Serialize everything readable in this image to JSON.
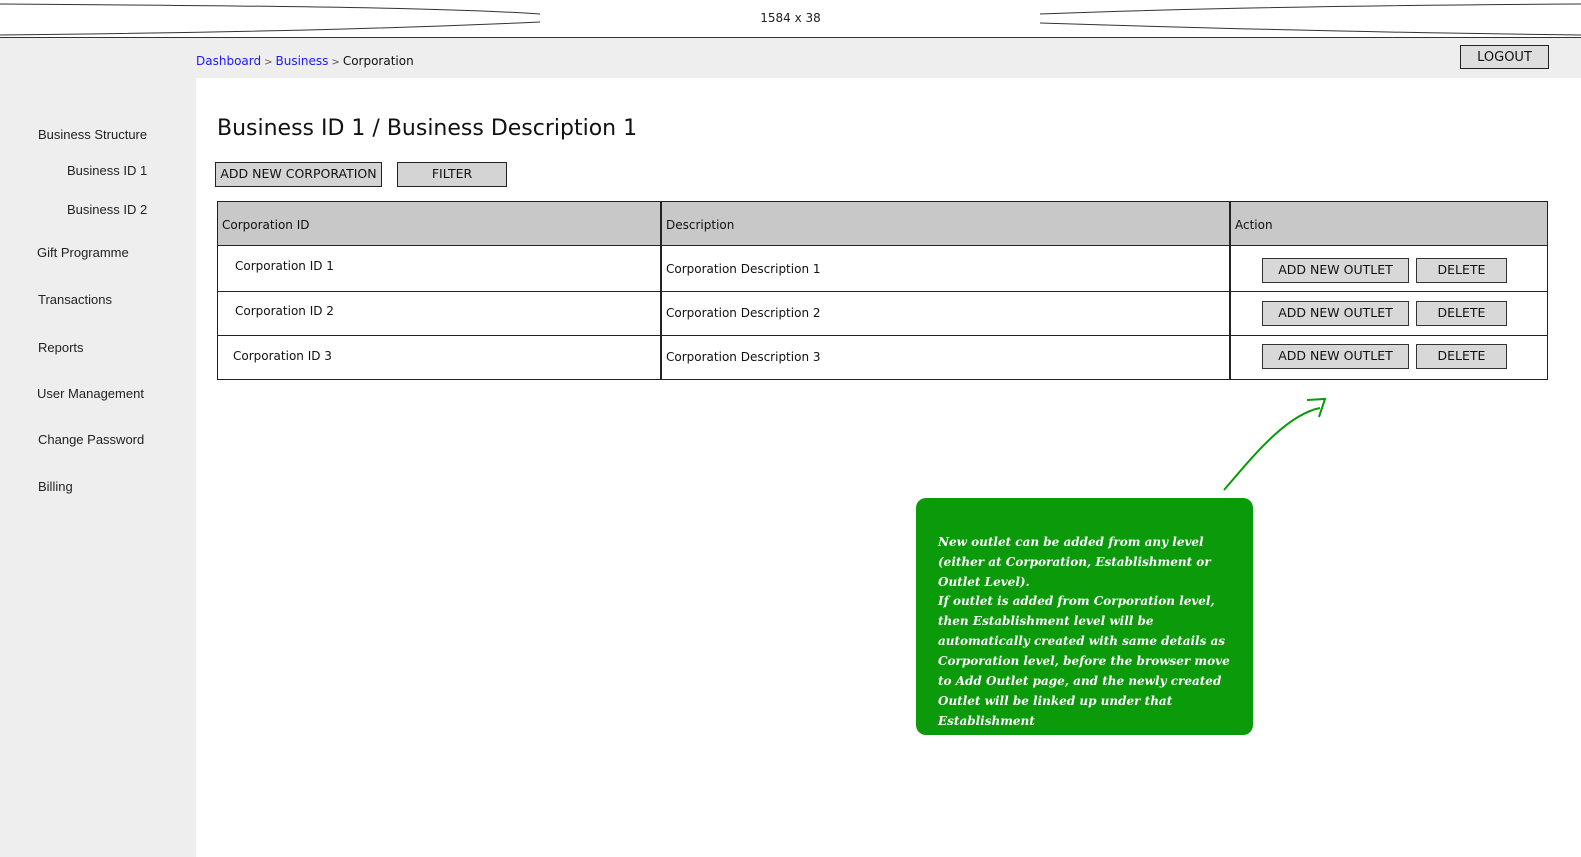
{
  "banner": {
    "dimensions": "1584 x 38"
  },
  "breadcrumb": {
    "items": [
      "Dashboard",
      "Business"
    ],
    "current": "Corporation",
    "separator": ">"
  },
  "header": {
    "logout_label": "LOGOUT"
  },
  "sidebar": {
    "items": [
      {
        "label": "Business Structure"
      },
      {
        "label": "Business ID 1"
      },
      {
        "label": "Business ID 2"
      },
      {
        "label": "Gift Programme"
      },
      {
        "label": "Transactions"
      },
      {
        "label": "Reports"
      },
      {
        "label": "User Management"
      },
      {
        "label": "Change Password"
      },
      {
        "label": "Billing"
      }
    ]
  },
  "main": {
    "title": "Business ID 1 / Business Description 1",
    "toolbar": {
      "add_label": "ADD NEW CORPORATION",
      "filter_label": "FILTER"
    },
    "table": {
      "columns": [
        "Corporation ID",
        "Description",
        "Action"
      ],
      "rows": [
        {
          "id": "Corporation ID 1",
          "description": "Corporation Description 1",
          "add_outlet": "ADD NEW OUTLET",
          "delete": "DELETE"
        },
        {
          "id": "Corporation ID 2",
          "description": "Corporation Description 2",
          "add_outlet": "ADD NEW OUTLET",
          "delete": "DELETE"
        },
        {
          "id": "Corporation ID 3",
          "description": "Corporation Description 3",
          "add_outlet": "ADD NEW OUTLET",
          "delete": "DELETE"
        }
      ]
    }
  },
  "note": {
    "color": "#0a9a0a",
    "paragraph1": "New outlet can be added from any level (either at Corporation, Establishment or Outlet Level).",
    "paragraph2": "If outlet is added from Corporation level, then Establishment level will be automatically created with same details as Corporation level, before the browser move to Add Outlet page, and the newly created Outlet will be linked up under that Establishment"
  }
}
